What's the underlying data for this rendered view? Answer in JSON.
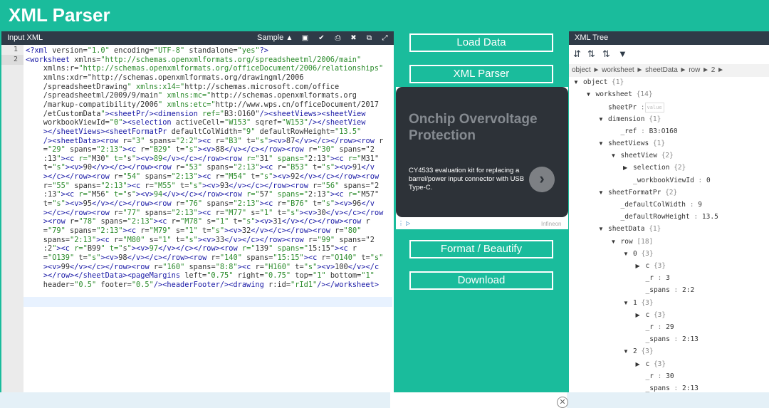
{
  "app": {
    "title": "XML Parser"
  },
  "input_panel": {
    "title": "Input XML",
    "sample_label": "Sample",
    "toolbar_icons": [
      "folder-open-icon",
      "save-icon",
      "check-icon",
      "print-icon",
      "clear-icon",
      "copy-icon",
      "fullscreen-icon"
    ]
  },
  "editor": {
    "line_numbers": [
      "1",
      "2"
    ]
  },
  "buttons": {
    "load": "Load Data",
    "parse": "XML Parser",
    "format": "Format / Beautify",
    "download": "Download"
  },
  "ad": {
    "headline": "Onchip Overvoltage Protection",
    "text": "CY4533 evaluation kit for replacing a barrel/power input connector with USB Type-C.",
    "brand": "Infineon"
  },
  "tree_panel": {
    "title": "XML Tree",
    "toolbar_icons": [
      "expand-all-icon",
      "collapse-all-icon",
      "sort-icon",
      "filter-icon"
    ],
    "breadcrumb": "object ► worksheet ► sheetData ► row ► 2 ►",
    "value_placeholder": "value",
    "nodes": [
      {
        "k": "object",
        "c": "{1}"
      },
      {
        "k": "worksheet",
        "c": "{14}"
      },
      {
        "k": "sheetPr",
        "c": ":"
      },
      {
        "k": "dimension",
        "c": "{1}"
      },
      {
        "k": "_ref",
        "c": ":",
        "v": "B3:O160"
      },
      {
        "k": "sheetViews",
        "c": "{1}"
      },
      {
        "k": "sheetView",
        "c": "{2}"
      },
      {
        "k": "selection",
        "c": "{2}"
      },
      {
        "k": "_workbookViewId",
        "c": ":",
        "v": "0"
      },
      {
        "k": "sheetFormatPr",
        "c": "{2}"
      },
      {
        "k": "_defaultColWidth",
        "c": ":",
        "v": "9"
      },
      {
        "k": "_defaultRowHeight",
        "c": ":",
        "v": "13.5"
      },
      {
        "k": "sheetData",
        "c": "{1}"
      },
      {
        "k": "row",
        "c": "[18]"
      },
      {
        "k": "0",
        "c": "{3}"
      },
      {
        "k": "c",
        "c": "{3}"
      },
      {
        "k": "_r",
        "c": ":",
        "v": "3"
      },
      {
        "k": "_spans",
        "c": ":",
        "v": "2:2"
      },
      {
        "k": "1",
        "c": "{3}"
      },
      {
        "k": "c",
        "c": "{3}"
      },
      {
        "k": "_r",
        "c": ":",
        "v": "29"
      },
      {
        "k": "_spans",
        "c": ":",
        "v": "2:13"
      },
      {
        "k": "2",
        "c": "{3}"
      },
      {
        "k": "c",
        "c": "{3}"
      },
      {
        "k": "_r",
        "c": ":",
        "v": "30"
      },
      {
        "k": "_spans",
        "c": ":",
        "v": "2:13"
      }
    ]
  }
}
